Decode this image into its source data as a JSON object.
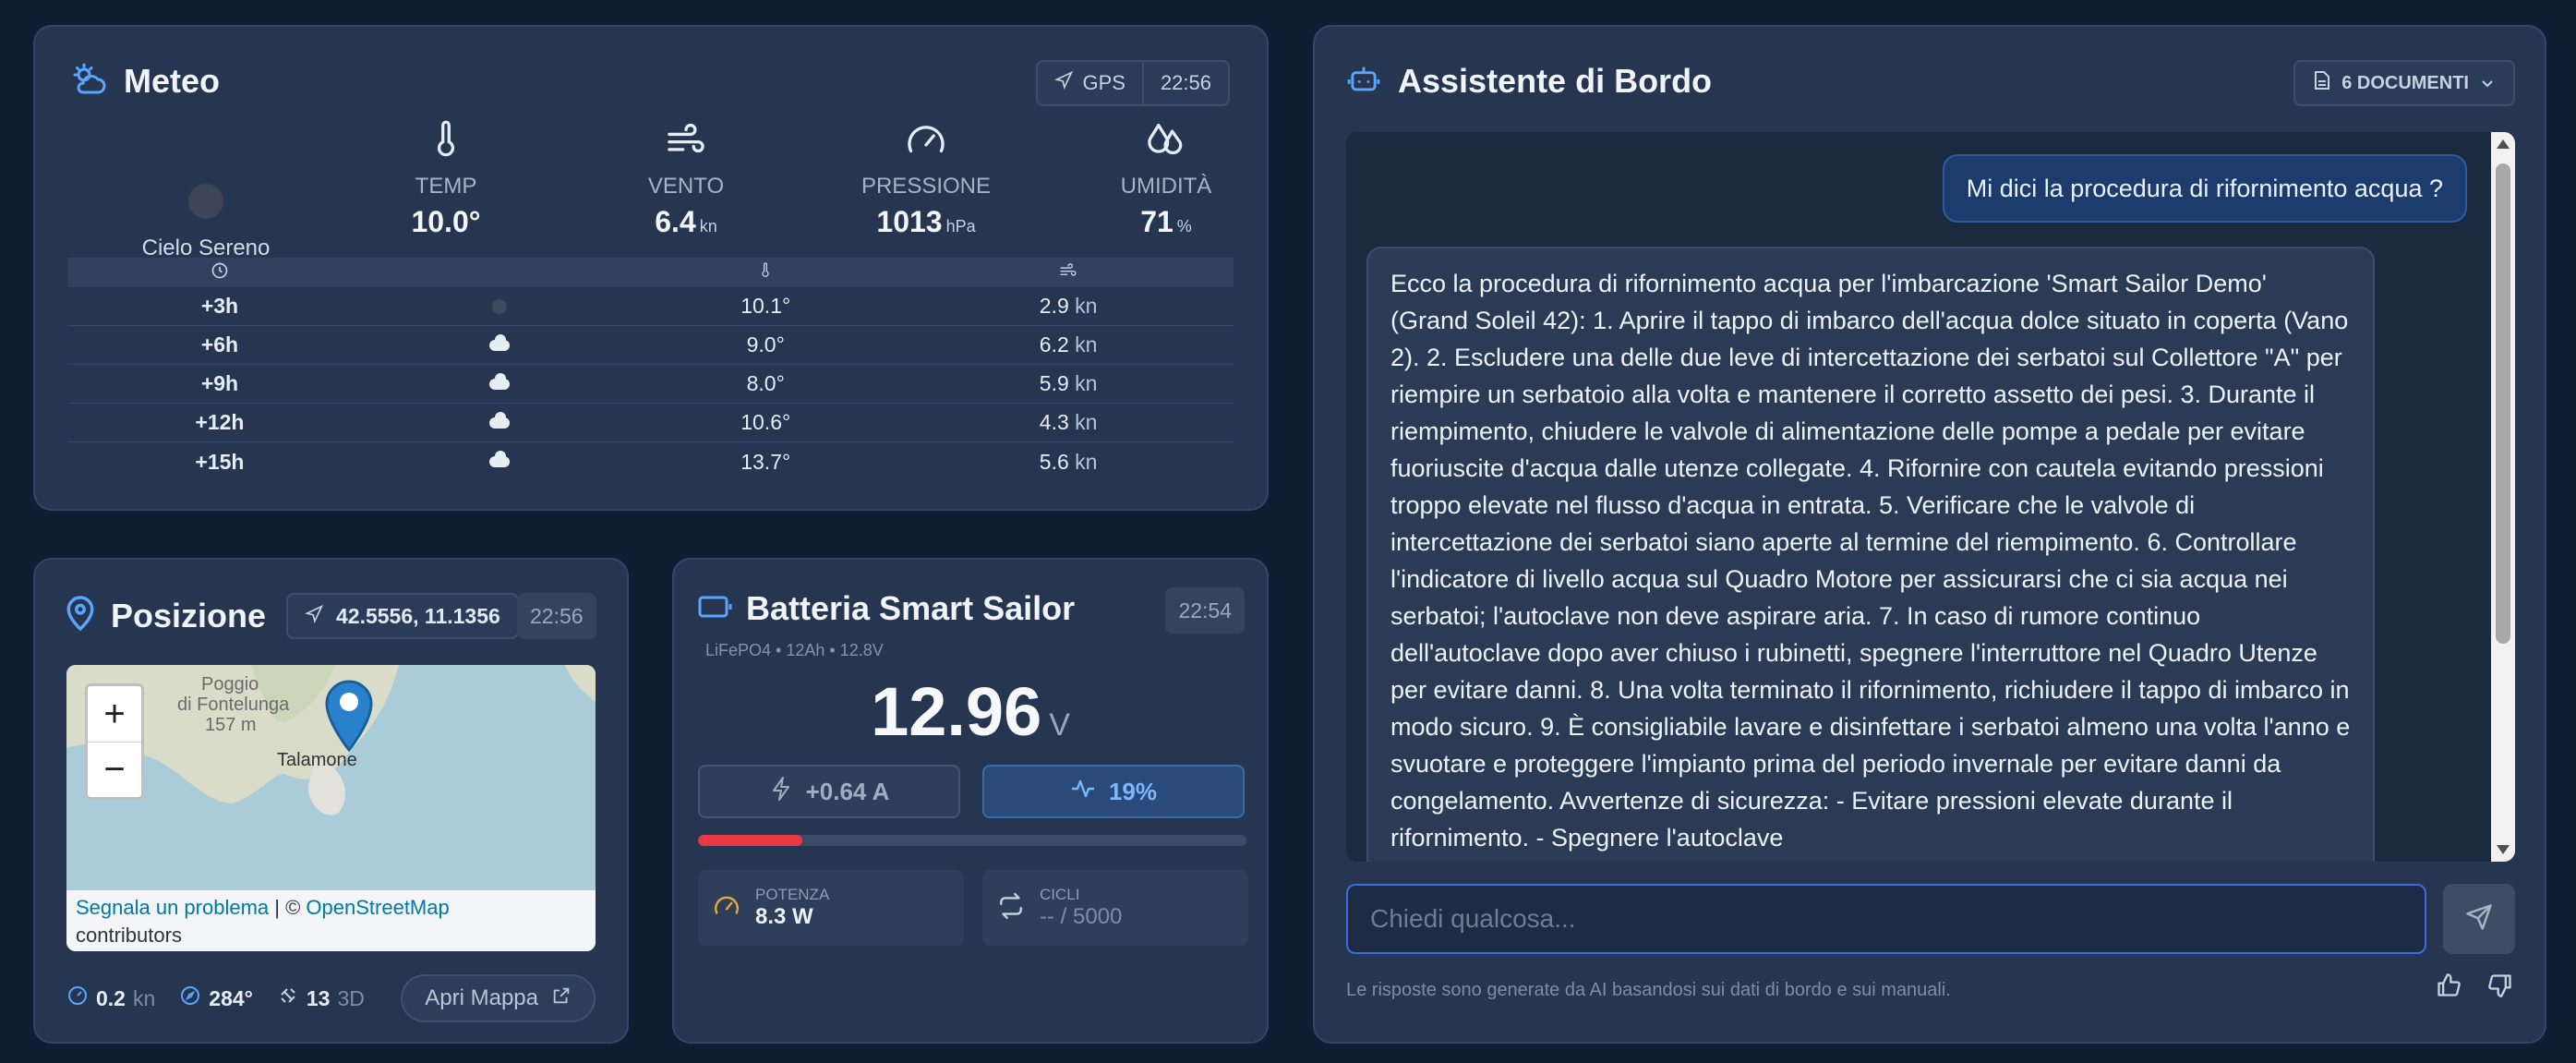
{
  "meteo": {
    "title": "Meteo",
    "gps_label": "GPS",
    "time": "22:56",
    "sky": "Cielo Sereno",
    "metrics": [
      {
        "label": "TEMP",
        "value": "10.0°",
        "unit": ""
      },
      {
        "label": "VENTO",
        "value": "6.4",
        "unit": "kn"
      },
      {
        "label": "PRESSIONE",
        "value": "1013",
        "unit": "hPa"
      },
      {
        "label": "UMIDITÀ",
        "value": "71",
        "unit": "%"
      }
    ],
    "forecast": [
      {
        "offset": "+3h",
        "icon": "clear-night",
        "temp": "10.1°",
        "wind": "2.9",
        "unit": "kn"
      },
      {
        "offset": "+6h",
        "icon": "cloud",
        "temp": "9.0°",
        "wind": "6.2",
        "unit": "kn"
      },
      {
        "offset": "+9h",
        "icon": "cloud",
        "temp": "8.0°",
        "wind": "5.9",
        "unit": "kn"
      },
      {
        "offset": "+12h",
        "icon": "cloud",
        "temp": "10.6°",
        "wind": "4.3",
        "unit": "kn"
      },
      {
        "offset": "+15h",
        "icon": "cloud",
        "temp": "13.7°",
        "wind": "5.6",
        "unit": "kn"
      }
    ]
  },
  "posizione": {
    "title": "Posizione",
    "coords": "42.5556, 11.1356",
    "time": "22:56",
    "map": {
      "place1": "Poggio",
      "place2": "di Fontelunga",
      "place3": "157 m",
      "town": "Talamone",
      "zoom_in": "+",
      "zoom_out": "−",
      "attrib_link1": "Segnala un problema",
      "attrib_sep": " | © ",
      "attrib_link2": "OpenStreetMap",
      "attrib_tail": "contributors"
    },
    "speed": "0.2",
    "speed_unit": "kn",
    "heading": "284°",
    "satellites": "13",
    "fix": "3D",
    "open_map": "Apri Mappa"
  },
  "batteria": {
    "title": "Batteria Smart Sailor",
    "time": "22:54",
    "subtitle": "LiFePO4 • 12Ah • 12.8V",
    "voltage": "12.96",
    "voltage_unit": "V",
    "current": "+0.64 A",
    "soc": "19%",
    "soc_fraction": 0.19,
    "power_label": "POTENZA",
    "power_value": "8.3 W",
    "cycles_label": "CICLI",
    "cycles_value": "-- / 5000"
  },
  "assistente": {
    "title": "Assistente di Bordo",
    "docs": "6 DOCUMENTI",
    "user_message": "Mi dici la procedura di rifornimento acqua ?",
    "bot_message": "Ecco la procedura di rifornimento acqua per l'imbarcazione 'Smart Sailor Demo' (Grand Soleil 42): 1. Aprire il tappo di imbarco dell'acqua dolce situato in coperta (Vano 2). 2. Escludere una delle due leve di intercettazione dei serbatoi sul Collettore \"A\" per riempire un serbatoio alla volta e mantenere il corretto assetto dei pesi. 3. Durante il riempimento, chiudere le valvole di alimentazione delle pompe a pedale per evitare fuoriuscite d'acqua dalle utenze collegate. 4. Rifornire con cautela evitando pressioni troppo elevate nel flusso d'acqua in entrata. 5. Verificare che le valvole di intercettazione dei serbatoi siano aperte al termine del riempimento. 6. Controllare l'indicatore di livello acqua sul Quadro Motore per assicurarsi che ci sia acqua nei serbatoi; l'autoclave non deve aspirare aria. 7. In caso di rumore continuo dell'autoclave dopo aver chiuso i rubinetti, spegnere l'interruttore nel Quadro Utenze per evitare danni. 8. Una volta terminato il rifornimento, richiudere il tappo di imbarco in modo sicuro. 9. È consigliabile lavare e disinfettare i serbatoi almeno una volta l'anno e svuotare e proteggere l'impianto prima del periodo invernale per evitare danni da congelamento. Avvertenze di sicurezza: - Evitare pressioni elevate durante il rifornimento. - Spegnere l'autoclave",
    "input_placeholder": "Chiedi qualcosa...",
    "disclaimer": "Le risposte sono generate da AI basandosi sui dati di bordo e sui manuali."
  },
  "colors": {
    "background": "#0f1e33",
    "panel": "#263650",
    "accent": "#3b82f6",
    "battery_low": "#e63946",
    "soc_text": "#79b8ff"
  }
}
